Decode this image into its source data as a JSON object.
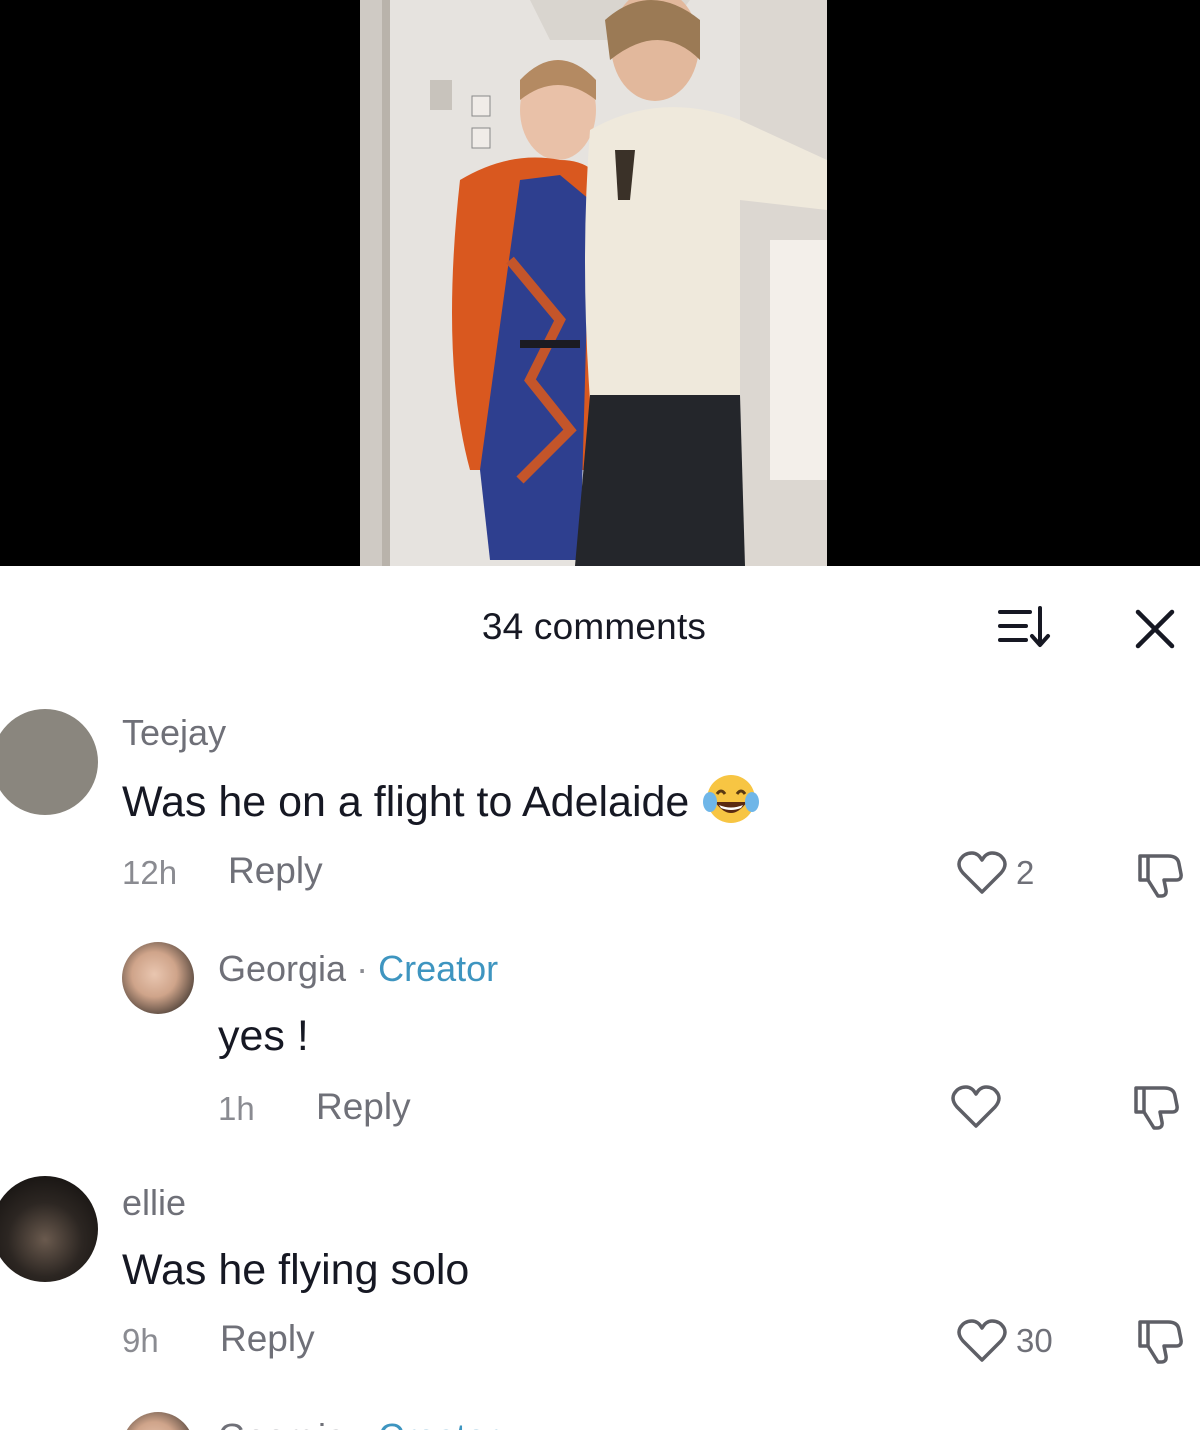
{
  "video": {
    "description_icon": "video-frame"
  },
  "header": {
    "title": "34 comments",
    "sort_icon": "sort-icon",
    "close_icon": "close-icon"
  },
  "comments": [
    {
      "username": "Teejay",
      "text": "Was he on a flight to Adelaide",
      "emoji": "face-with-tears-of-joy",
      "time": "12h",
      "reply_label": "Reply",
      "likes": "2",
      "avatar_color": "#8a867e"
    },
    {
      "username": "Georgia",
      "separator": "·",
      "badge": "Creator",
      "text": "yes !",
      "time": "1h",
      "reply_label": "Reply",
      "likes": ""
    },
    {
      "username": "ellie",
      "text": "Was he flying solo",
      "time": "9h",
      "reply_label": "Reply",
      "likes": "30"
    },
    {
      "username": "Georgia",
      "separator": "·",
      "badge": "Creator"
    }
  ],
  "colors": {
    "text_primary": "#161823",
    "text_secondary": "#6f7078",
    "creator_badge": "#3e95c0",
    "video_background": "#000000"
  }
}
